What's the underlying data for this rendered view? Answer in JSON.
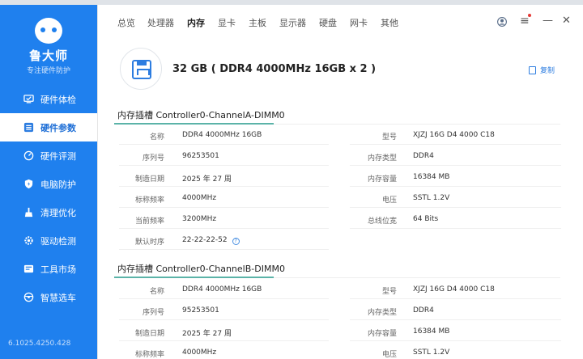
{
  "sidebar": {
    "logo_name": "鲁大师",
    "logo_sub": "专注硬件防护",
    "items": [
      {
        "label": "硬件体检",
        "icon": "monitor-check-icon"
      },
      {
        "label": "硬件参数",
        "icon": "list-icon"
      },
      {
        "label": "硬件评测",
        "icon": "gauge-icon"
      },
      {
        "label": "电脑防护",
        "icon": "shield-icon"
      },
      {
        "label": "清理优化",
        "icon": "broom-icon"
      },
      {
        "label": "驱动检测",
        "icon": "gear-icon"
      },
      {
        "label": "工具市场",
        "icon": "grid-icon"
      },
      {
        "label": "智慧选车",
        "icon": "steering-icon"
      }
    ],
    "active_index": 1,
    "version": "6.1025.4250.428"
  },
  "tabs": [
    "总览",
    "处理器",
    "内存",
    "显卡",
    "主板",
    "显示器",
    "硬盘",
    "网卡",
    "其他"
  ],
  "active_tab": 2,
  "headline": "32 GB ( DDR4 4000MHz 16GB x 2 )",
  "copy_label": "复制",
  "sections": [
    {
      "title": "内存插槽 Controller0-ChannelA-DIMM0",
      "left": [
        {
          "k": "名称",
          "v": "DDR4 4000MHz 16GB"
        },
        {
          "k": "序列号",
          "v": "96253501"
        },
        {
          "k": "制造日期",
          "v": "2025 年 27 周"
        },
        {
          "k": "标称频率",
          "v": "4000MHz"
        },
        {
          "k": "当前频率",
          "v": "3200MHz"
        },
        {
          "k": "默认时序",
          "v": "22-22-22-52"
        }
      ],
      "right": [
        {
          "k": "型号",
          "v": "XJZJ 16G D4 4000 C18"
        },
        {
          "k": "内存类型",
          "v": "DDR4"
        },
        {
          "k": "内存容量",
          "v": "16384 MB"
        },
        {
          "k": "电压",
          "v": "SSTL 1.2V"
        },
        {
          "k": "总线位宽",
          "v": "64 Bits"
        }
      ]
    },
    {
      "title": "内存插槽 Controller0-ChannelB-DIMM0",
      "left": [
        {
          "k": "名称",
          "v": "DDR4 4000MHz 16GB"
        },
        {
          "k": "序列号",
          "v": "95253501"
        },
        {
          "k": "制造日期",
          "v": "2025 年 27 周"
        },
        {
          "k": "标称频率",
          "v": "4000MHz"
        }
      ],
      "right": [
        {
          "k": "型号",
          "v": "XJZJ 16G D4 4000 C18"
        },
        {
          "k": "内存类型",
          "v": "DDR4"
        },
        {
          "k": "内存容量",
          "v": "16384 MB"
        },
        {
          "k": "电压",
          "v": "SSTL 1.2V"
        }
      ]
    }
  ]
}
